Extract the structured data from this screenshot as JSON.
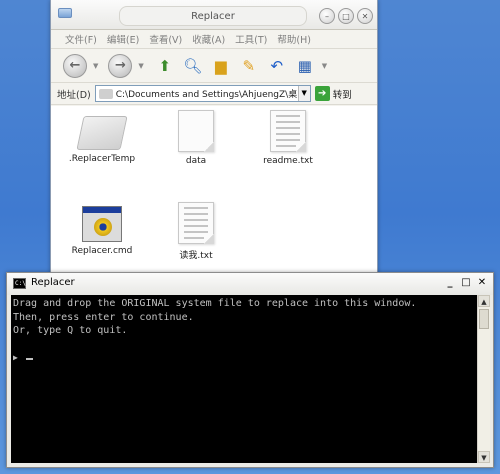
{
  "explorer": {
    "title": "Replacer",
    "menu": [
      "文件(F)",
      "编辑(E)",
      "查看(V)",
      "收藏(A)",
      "工具(T)",
      "帮助(H)"
    ],
    "address_label": "地址(D)",
    "address_value": "C:\\Documents and Settings\\AhjuengZ\\桌",
    "go_label": "转到",
    "files": [
      {
        "name": ".ReplacerTemp",
        "icon": "folder-icon"
      },
      {
        "name": "data",
        "icon": "file-icon"
      },
      {
        "name": "readme.txt",
        "icon": "text-file-icon"
      },
      {
        "name": "Replacer.cmd",
        "icon": "batch-file-icon"
      },
      {
        "name": "读我.txt",
        "icon": "text-file-icon"
      }
    ]
  },
  "console": {
    "title": "Replacer",
    "lines": [
      "Drag and drop the ORIGINAL system file to replace into this window.",
      "Then, press enter to continue.",
      "Or, type Q to quit."
    ],
    "prompt_glyph": "▶"
  }
}
